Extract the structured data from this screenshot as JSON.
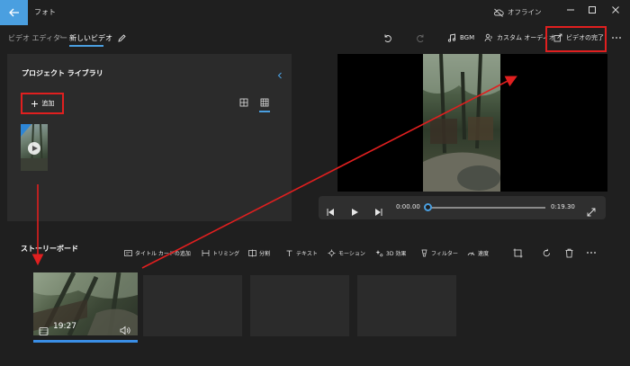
{
  "app": {
    "title": "フォト",
    "offline": "オフライン"
  },
  "breadcrumb": {
    "root": "ビデオ エディター",
    "separator": "›",
    "current": "新しいビデオ"
  },
  "toolbar": {
    "bgm": "BGM",
    "custom_audio": "カスタム オーディオ",
    "finish_video": "ビデオの完了"
  },
  "library": {
    "title": "プロジェクト ライブラリ",
    "add_label": "追加"
  },
  "player": {
    "current_time": "0:00.00",
    "total_time": "0:19.30",
    "progress": 0.0
  },
  "storyboard": {
    "title": "ストーリーボード",
    "tools": [
      "タイトル カードの追加",
      "トリミング",
      "分割",
      "テキスト",
      "モーション",
      "3D 効果",
      "フィルター",
      "速度"
    ],
    "clip_duration": "19:27"
  },
  "colors": {
    "accent": "#4a9fe0",
    "highlight": "#e01f1f",
    "background": "#1f1f1f",
    "panel": "#2b2b2b"
  }
}
